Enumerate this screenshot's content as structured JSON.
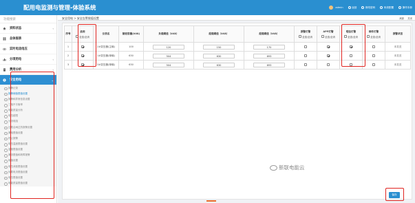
{
  "header": {
    "title": "配用电监测与管理-体验系统",
    "user": "admin",
    "actions": [
      "返回",
      "修改密码",
      "系统配置",
      "操作手册"
    ]
  },
  "sidebar": {
    "search_placeholder": "功能搜索",
    "items": [
      {
        "label": "资料状态",
        "icon": "star-icon"
      },
      {
        "label": "总体报表",
        "icon": "grid-icon"
      },
      {
        "label": "实时电流电压",
        "icon": "eye-icon"
      },
      {
        "label": "分项用电",
        "icon": "bar-chart-icon"
      },
      {
        "label": "费用分析",
        "icon": "document-icon"
      },
      {
        "label": "安全用电",
        "icon": "warning-icon"
      }
    ],
    "submenu": [
      "报警记录",
      "报警阈值限值设置",
      "报警和异常信息设置",
      "三相不平衡率",
      "电能质量分析",
      "电压越限",
      "分流电阻",
      "过载合闸过热报警设置",
      "漏电限值设置",
      "终止报警",
      "电压温度限值设置",
      "温度限值设置",
      "漏流限值和故障报警",
      "阈值设置",
      "电压消费限值设置",
      "负载电流限值设置",
      "电压限值设置",
      "电能质量限值设置"
    ]
  },
  "tabs": {
    "current": "安全用电 > 安全告警限值设置",
    "right": [
      "刷新",
      "关闭"
    ]
  },
  "table": {
    "columns": [
      "序号",
      "启用",
      "仪表名",
      "额定容量(kVA)",
      "负载阈值（kVA）",
      "超载阈值（kVA）",
      "超载阈值（kVA）",
      "报警灯警",
      "APP灯警",
      "短信灯警",
      "邮件灯警",
      "报警状态"
    ],
    "select_all_label": "全选/全消",
    "rows": [
      {
        "index": "1",
        "enabled": true,
        "meter": "2#变压器(主输)",
        "capacity": "100",
        "v1": "120",
        "v2": "150",
        "v3": "170",
        "light": false,
        "app": true,
        "sms": true,
        "mail": false,
        "status": "未发送"
      },
      {
        "index": "2",
        "enabled": true,
        "meter": "1#变压器(单输)",
        "capacity": "630",
        "v1": "504",
        "v2": "630",
        "v3": "693",
        "light": false,
        "app": true,
        "sms": false,
        "mail": false,
        "status": "未发送"
      },
      {
        "index": "3",
        "enabled": true,
        "meter": "3#变压器(单输)",
        "capacity": "630",
        "v1": "504",
        "v2": "630",
        "v3": "693",
        "light": false,
        "app": false,
        "sms": false,
        "mail": false,
        "status": "未发送"
      }
    ]
  },
  "watermark": "新联电能云",
  "save_button": "保存",
  "colors": {
    "header": "#2a8fd0",
    "active_nav": "#2e8fd2",
    "highlight": "#e0231f",
    "button": "#2a8fd0"
  }
}
